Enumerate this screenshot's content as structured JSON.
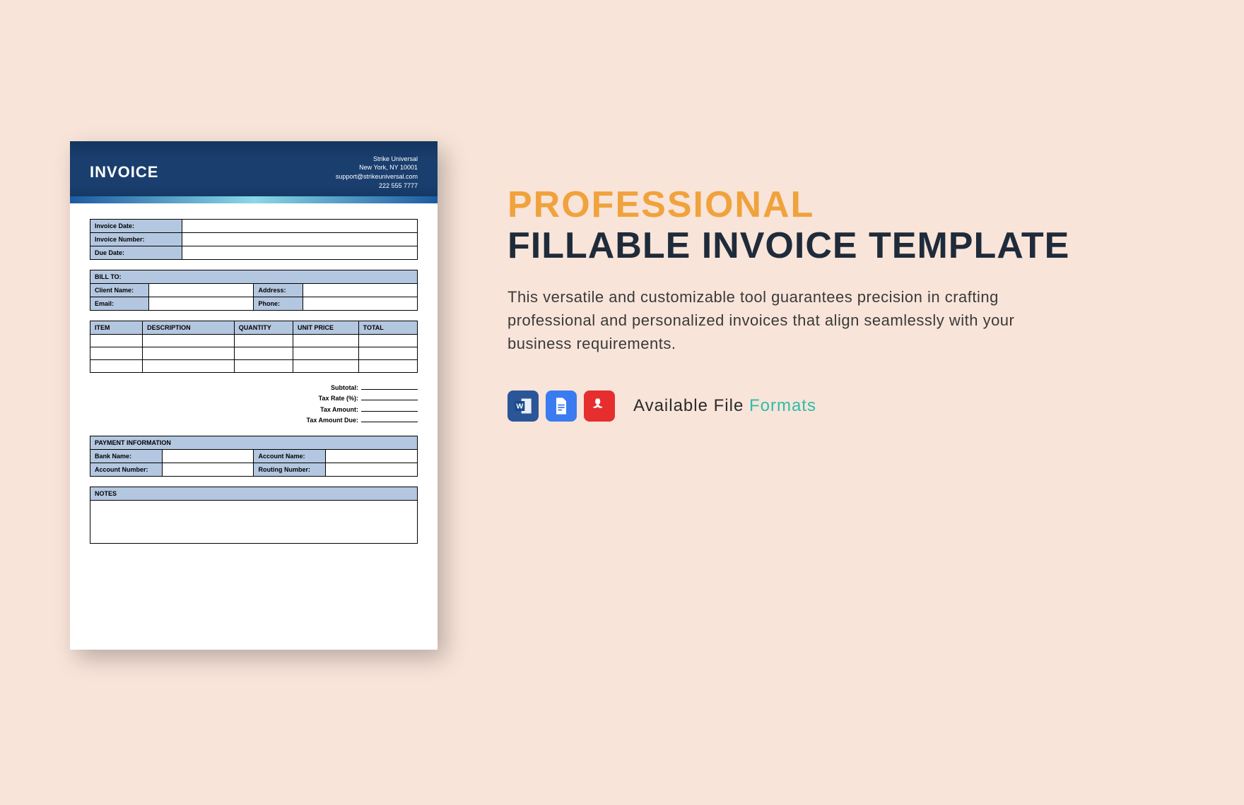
{
  "invoice": {
    "title": "INVOICE",
    "company": {
      "name": "Strike Universal",
      "city": "New York, NY 10001",
      "email": "support@strikeuniversal.com",
      "phone": "222 555 7777"
    },
    "meta_labels": {
      "invoice_date": "Invoice Date:",
      "invoice_number": "Invoice Number:",
      "due_date": "Due Date:"
    },
    "bill_to": {
      "heading": "BILL TO:",
      "client_name": "Client Name:",
      "address": "Address:",
      "email": "Email:",
      "phone": "Phone:"
    },
    "columns": {
      "item": "ITEM",
      "description": "DESCRIPTION",
      "quantity": "QUANTITY",
      "unit_price": "UNIT PRICE",
      "total": "TOTAL"
    },
    "totals": {
      "subtotal": "Subtotal:",
      "tax_rate": "Tax Rate (%):",
      "tax_amount": "Tax Amount:",
      "tax_amount_due": "Tax Amount Due:"
    },
    "payment": {
      "heading": "PAYMENT INFORMATION",
      "bank_name": "Bank Name:",
      "account_name": "Account Name:",
      "account_number": "Account Number:",
      "routing_number": "Routing Number:"
    },
    "notes_heading": "NOTES"
  },
  "promo": {
    "title_accent": "PROFESSIONAL",
    "title_rest": "FILLABLE INVOICE TEMPLATE",
    "description": "This versatile and customizable tool guarantees precision in crafting professional and personalized invoices that align seamlessly with your business requirements.",
    "formats_label_a": "Available File ",
    "formats_label_b": "Formats",
    "icons": [
      "word-icon",
      "google-docs-icon",
      "pdf-icon"
    ]
  }
}
